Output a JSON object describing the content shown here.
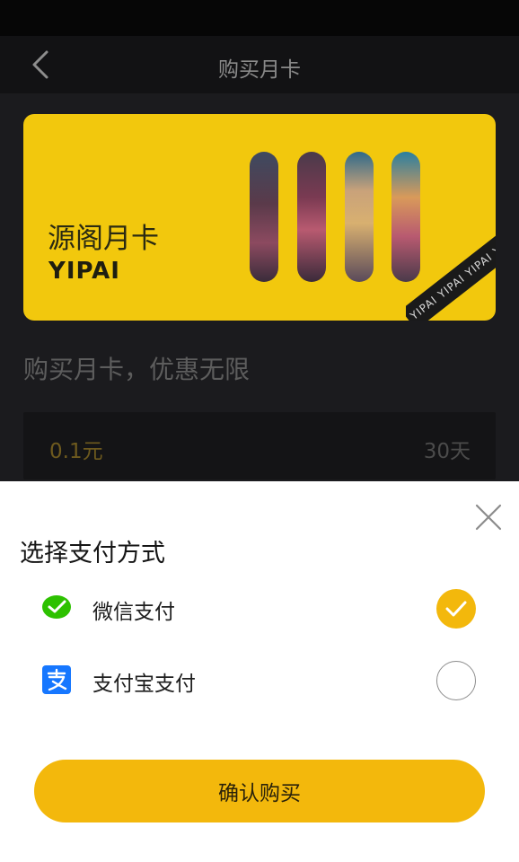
{
  "nav": {
    "title": "购买月卡"
  },
  "card": {
    "name": "源阁月卡",
    "brand": "YIPAI",
    "ribbon_text": "YIPAI YIPAI YIPAI YIPAI",
    "color": "#f2c80d"
  },
  "promo": {
    "slogan": "购买月卡，优惠无限"
  },
  "plan": {
    "price": "0.1元",
    "duration": "30天"
  },
  "payment_sheet": {
    "title": "选择支付方式",
    "methods": [
      {
        "label": "微信支付",
        "icon": "wechat-pay-icon",
        "selected": true
      },
      {
        "label": "支付宝支付",
        "icon": "alipay-icon",
        "selected": false
      }
    ],
    "confirm_label": "确认购买"
  },
  "colors": {
    "accent": "#f3b80c",
    "wechat_green": "#2dc100",
    "alipay_blue": "#1677ff"
  }
}
